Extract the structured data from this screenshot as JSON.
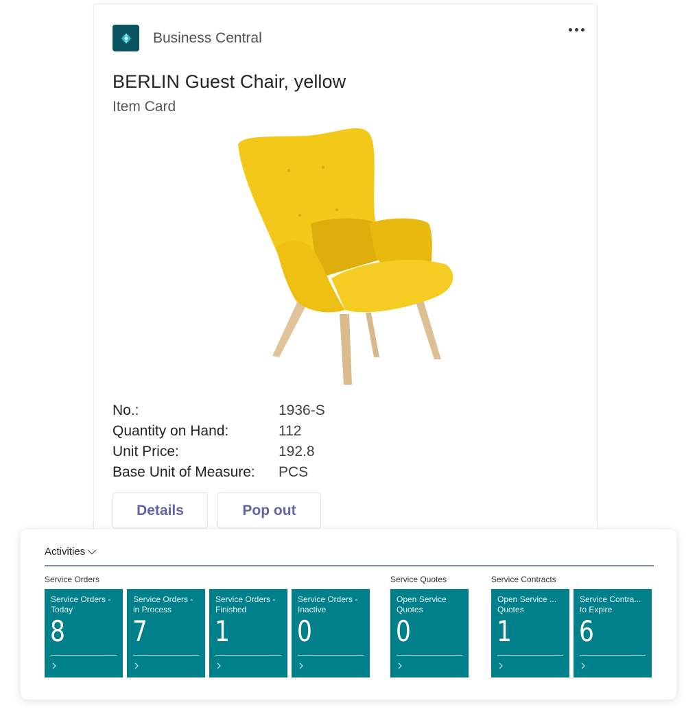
{
  "card": {
    "app_icon": "business-central-logo-icon",
    "app_name": "Business Central",
    "more_icon": "more-options-icon",
    "title": "BERLIN Guest Chair, yellow",
    "subtitle": "Item Card",
    "image_alt": "Yellow wingback guest chair with wooden legs",
    "facts": [
      {
        "label": "No.:",
        "value": "1936-S"
      },
      {
        "label": "Quantity on Hand:",
        "value": "112"
      },
      {
        "label": "Unit Price:",
        "value": "192.8"
      },
      {
        "label": "Base Unit of Measure:",
        "value": "PCS"
      }
    ],
    "actions": {
      "details": "Details",
      "pop_out": "Pop out"
    },
    "colors": {
      "action_text": "#6264a7",
      "logo_bg": "#0b5561"
    }
  },
  "activities": {
    "title": "Activities",
    "toggle_icon": "chevron-down-icon",
    "tile_color": "#00808b",
    "groups": [
      {
        "title": "Service Orders",
        "tiles": [
          {
            "label": "Service Orders -\nToday",
            "value": "8"
          },
          {
            "label": "Service Orders -\nin Process",
            "value": "7"
          },
          {
            "label": "Service Orders -\nFinished",
            "value": "1"
          },
          {
            "label": "Service Orders -\nInactive",
            "value": "0"
          }
        ]
      },
      {
        "title": "Service Quotes",
        "tiles": [
          {
            "label": "Open Service\nQuotes",
            "value": "0"
          }
        ]
      },
      {
        "title": "Service Contracts",
        "tiles": [
          {
            "label": "Open Service ...\nQuotes",
            "value": "1"
          },
          {
            "label": "Service Contra...\nto Expire",
            "value": "6"
          }
        ]
      }
    ]
  }
}
